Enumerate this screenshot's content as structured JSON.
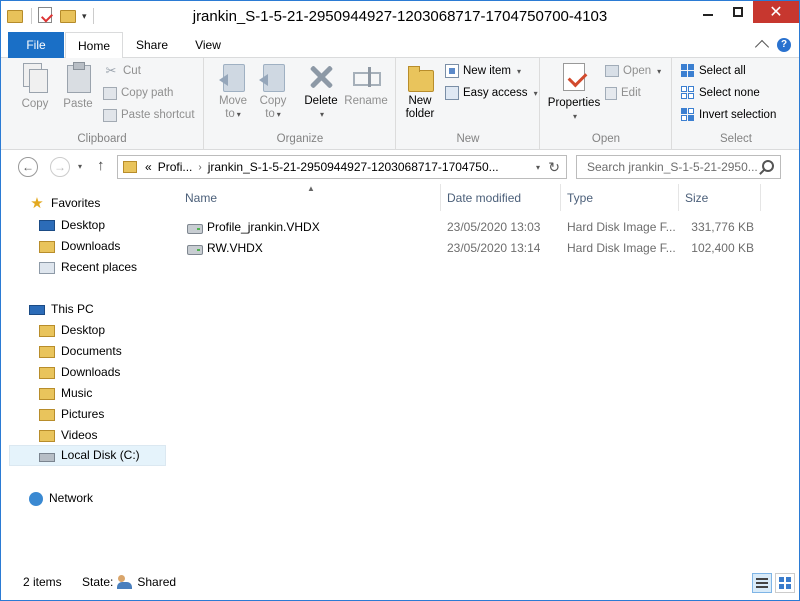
{
  "window": {
    "title": "jrankin_S-1-5-21-2950944927-1203068717-1704750700-4103"
  },
  "tabs": {
    "file": "File",
    "home": "Home",
    "share": "Share",
    "view": "View",
    "help": "?"
  },
  "ribbon": {
    "clipboard": {
      "label": "Clipboard",
      "copy": "Copy",
      "paste": "Paste",
      "cut": "Cut",
      "copy_path": "Copy path",
      "paste_shortcut": "Paste shortcut"
    },
    "organize": {
      "label": "Organize",
      "move_to_1": "Move",
      "move_to_2": "to",
      "copy_to_1": "Copy",
      "copy_to_2": "to",
      "delete": "Delete",
      "rename": "Rename"
    },
    "new": {
      "label": "New",
      "new_folder_1": "New",
      "new_folder_2": "folder",
      "new_item": "New item",
      "easy_access": "Easy access"
    },
    "open": {
      "label": "Open",
      "properties": "Properties",
      "open": "Open",
      "edit": "Edit"
    },
    "select": {
      "label": "Select",
      "select_all": "Select all",
      "select_none": "Select none",
      "invert_selection": "Invert selection"
    }
  },
  "address": {
    "overflow": "«",
    "parts": [
      "Profi...",
      "jrankin_S-1-5-21-2950944927-1203068717-1704750..."
    ]
  },
  "search": {
    "placeholder": "Search jrankin_S-1-5-21-2950..."
  },
  "nav": {
    "favorites": "Favorites",
    "fav_items": [
      "Desktop",
      "Downloads",
      "Recent places"
    ],
    "this_pc": "This PC",
    "pc_items": [
      "Desktop",
      "Documents",
      "Downloads",
      "Music",
      "Pictures",
      "Videos",
      "Local Disk (C:)"
    ],
    "network": "Network"
  },
  "columns": {
    "name": "Name",
    "date_modified": "Date modified",
    "type": "Type",
    "size": "Size"
  },
  "files": [
    {
      "name": "Profile_jrankin.VHDX",
      "date": "23/05/2020 13:03",
      "type": "Hard Disk Image F...",
      "size": "331,776 KB"
    },
    {
      "name": "RW.VHDX",
      "date": "23/05/2020 13:14",
      "type": "Hard Disk Image F...",
      "size": "102,400 KB"
    }
  ],
  "status": {
    "count": "2 items",
    "state_label": "State:",
    "state_value": "Shared"
  },
  "colors": {
    "accent": "#1a6fc6",
    "close": "#c7372f",
    "selected_bg": "#e5f3fb"
  }
}
